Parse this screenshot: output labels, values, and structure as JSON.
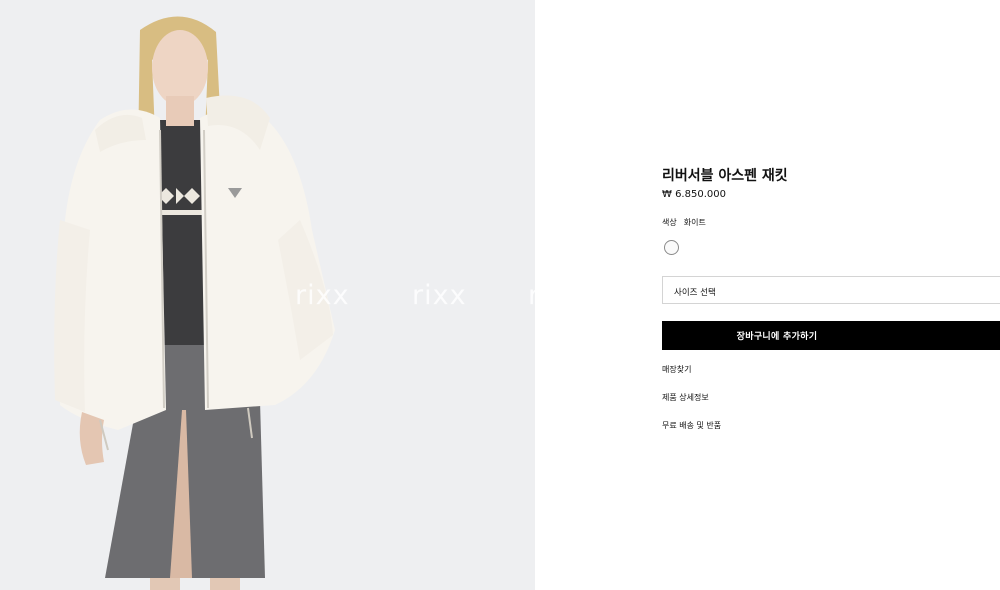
{
  "product": {
    "name": "리버서블 아스펜 재킷",
    "price": "₩ 6.850.000",
    "color_label": "색상",
    "color_value": "화이트",
    "swatch_color": "#fafafa",
    "size_placeholder": "사이즈 선택",
    "add_to_cart": "장바구니에 추가하기"
  },
  "links": {
    "store_locator": "매장찾기",
    "product_details": "제품 상세정보",
    "shipping_returns": "무료 배송 및 반품"
  },
  "watermark": "rixx"
}
